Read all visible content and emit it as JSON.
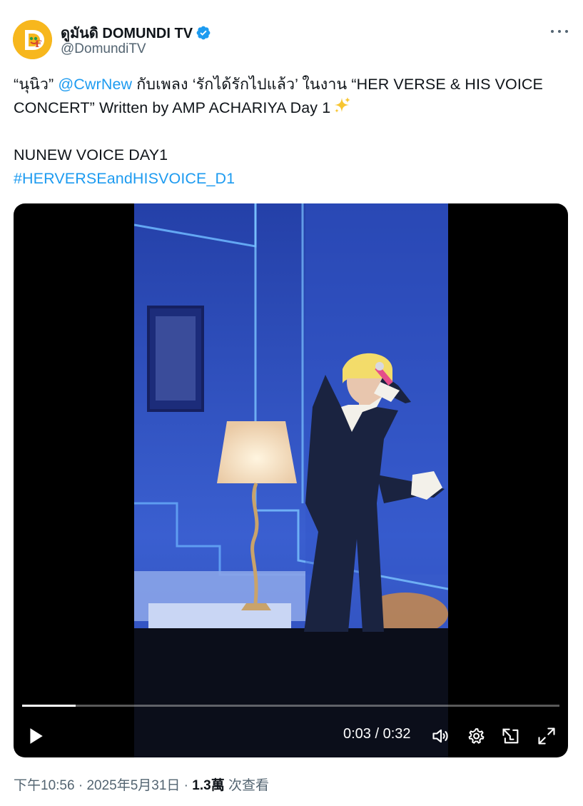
{
  "author": {
    "display_name": "ดูมันดิ DOMUNDI TV",
    "handle": "@DomundiTV",
    "verified": true,
    "avatar_text": "D"
  },
  "tweet": {
    "line1_before": "“นุนิว” ",
    "line1_mention": "@CwrNew",
    "line1_after": " กับเพลง ‘รักได้รักไปแล้ว’ ในงาน “HER VERSE & HIS VOICE",
    "line2": "CONCERT” Written by AMP ACHARIYA Day 1",
    "line2_emoji": "sparkles",
    "line3": "NUNEW VOICE DAY1",
    "hashtag": "#HERVERSEandHISVOICE_D1"
  },
  "video": {
    "current_time": "0:03",
    "duration": "0:32",
    "time_label": "0:03 / 0:32",
    "progress": 0.1
  },
  "meta": {
    "time": "下午10:56",
    "separator1": " · ",
    "date": "2025年5月31日",
    "separator2": " · ",
    "views": "1.3萬",
    "views_label": " 次查看"
  },
  "colors": {
    "link": "#1d9bf0",
    "verified": "#1d9bf0",
    "secondary_text": "#536471"
  }
}
